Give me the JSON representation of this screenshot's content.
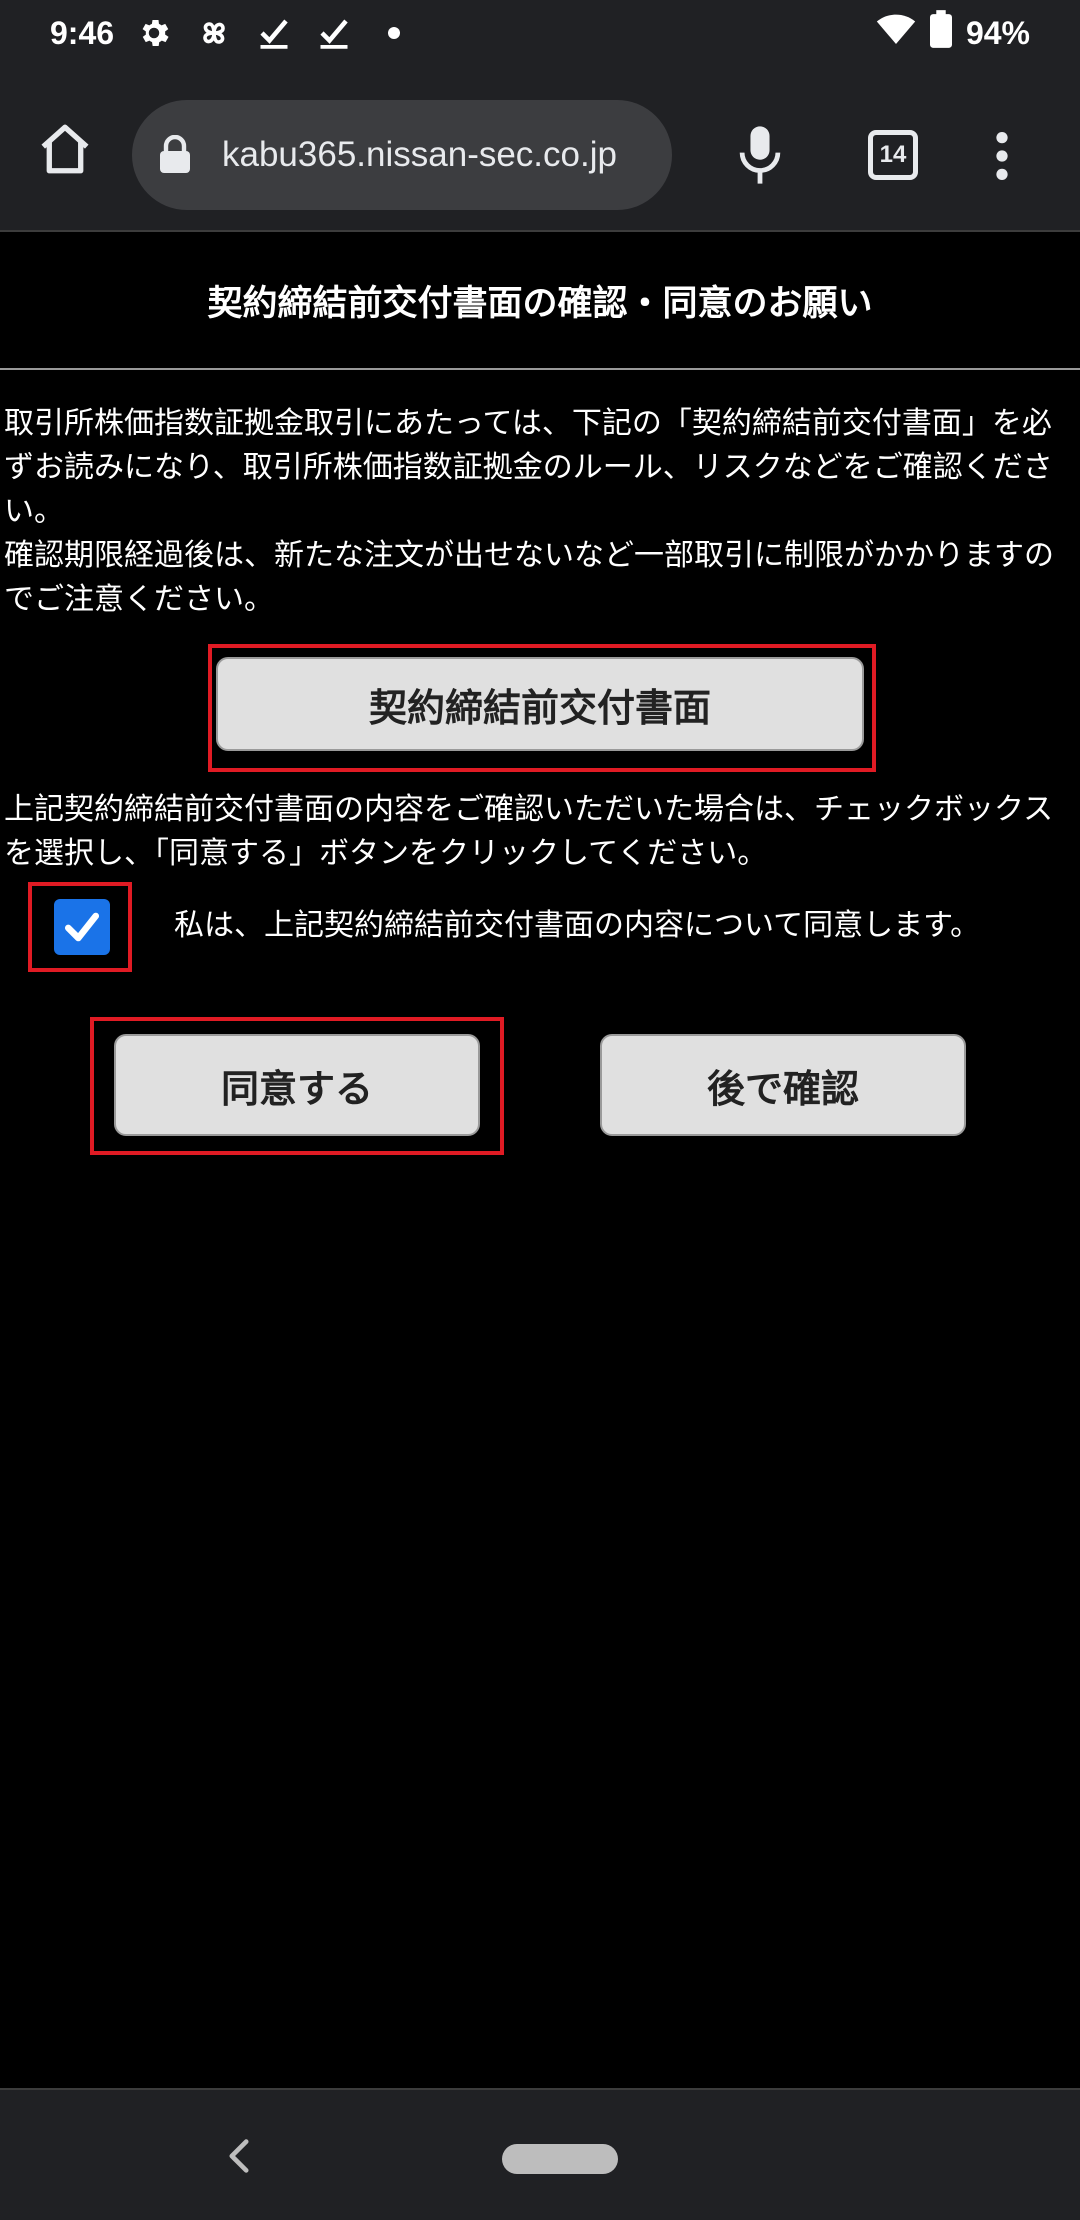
{
  "status_bar": {
    "time": "9:46",
    "battery": "94%",
    "icons": [
      "settings-icon",
      "pinwheel-icon",
      "check-icon",
      "check-icon",
      "dot-icon",
      "wifi-icon",
      "battery-icon"
    ]
  },
  "browser": {
    "url": "kabu365.nissan-sec.co.jp",
    "tab_count": "14"
  },
  "page": {
    "title": "契約締結前交付書面の確認・同意のお願い",
    "intro_1": "取引所株価指数証拠金取引にあたっては、下記の「契約締結前交付書面」を必ずお読みになり、取引所株価指数証拠金のルール、リスクなどをご確認ください。",
    "intro_2": "確認期限経過後は、新たな注文が出せないなど一部取引に制限がかかりますのでご注意ください。",
    "document_button": "契約締結前交付書面",
    "instruction": "上記契約締結前交付書面の内容をご確認いただいた場合は、チェックボックスを選択し、「同意する」ボタンをクリックしてください。",
    "agree_label": "私は、上記契約締結前交付書面の内容について同意します。",
    "agree_checked": true,
    "agree_button": "同意する",
    "later_button": "後で確認"
  },
  "colors": {
    "highlight": "#e01b24",
    "checkbox": "#1a73e8",
    "chrome_bar": "#202124"
  }
}
